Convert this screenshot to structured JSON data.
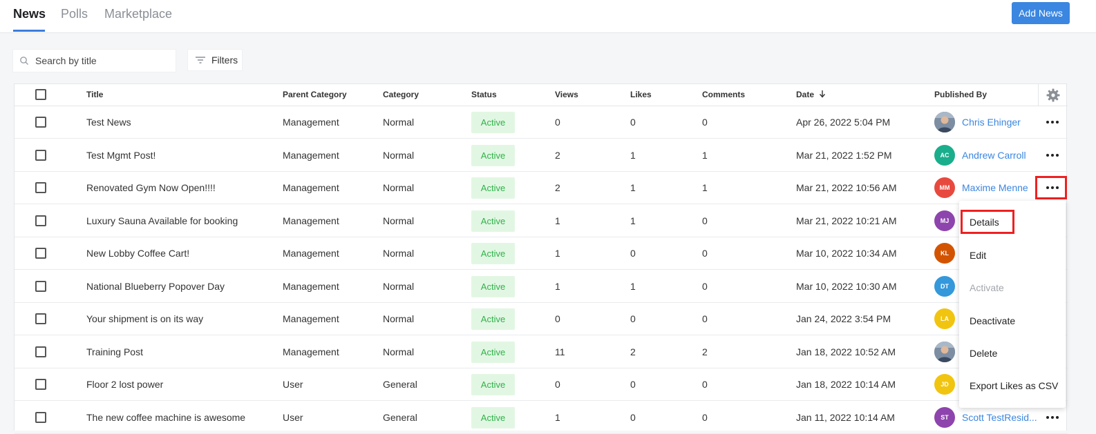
{
  "tabs": [
    {
      "label": "News",
      "active": true
    },
    {
      "label": "Polls",
      "active": false
    },
    {
      "label": "Marketplace",
      "active": false
    }
  ],
  "add_button_label": "Add News",
  "search": {
    "placeholder": "Search by title",
    "value": ""
  },
  "filters_label": "Filters",
  "columns": [
    "Title",
    "Parent Category",
    "Category",
    "Status",
    "Views",
    "Likes",
    "Comments",
    "Date",
    "Published By"
  ],
  "sort_column": "Date",
  "sort_direction": "descending",
  "rows": [
    {
      "title": "Test News",
      "parent_category": "Management",
      "category": "Normal",
      "status": "Active",
      "views": "0",
      "likes": "0",
      "comments": "0",
      "date": "Apr 26, 2022 5:04 PM",
      "initials": "",
      "avatar_color": "#6b7b90",
      "avatar_photo": true,
      "publisher": "Chris Ehinger"
    },
    {
      "title": "Test Mgmt Post!",
      "parent_category": "Management",
      "category": "Normal",
      "status": "Active",
      "views": "2",
      "likes": "1",
      "comments": "1",
      "date": "Mar 21, 2022 1:52 PM",
      "initials": "AC",
      "avatar_color": "#1aae8c",
      "avatar_photo": false,
      "publisher": "Andrew Carroll"
    },
    {
      "title": "Renovated Gym Now Open!!!!",
      "parent_category": "Management",
      "category": "Normal",
      "status": "Active",
      "views": "2",
      "likes": "1",
      "comments": "1",
      "date": "Mar 21, 2022 10:56 AM",
      "initials": "MM",
      "avatar_color": "#e8493f",
      "avatar_photo": false,
      "publisher": "Maxime Menne"
    },
    {
      "title": "Luxury Sauna Available for booking",
      "parent_category": "Management",
      "category": "Normal",
      "status": "Active",
      "views": "1",
      "likes": "1",
      "comments": "0",
      "date": "Mar 21, 2022 10:21 AM",
      "initials": "MJ",
      "avatar_color": "#8e44ad",
      "avatar_photo": false,
      "publisher": ""
    },
    {
      "title": "New Lobby Coffee Cart!",
      "parent_category": "Management",
      "category": "Normal",
      "status": "Active",
      "views": "1",
      "likes": "0",
      "comments": "0",
      "date": "Mar 10, 2022 10:34 AM",
      "initials": "KL",
      "avatar_color": "#d35400",
      "avatar_photo": false,
      "publisher": ""
    },
    {
      "title": "National Blueberry Popover Day",
      "parent_category": "Management",
      "category": "Normal",
      "status": "Active",
      "views": "1",
      "likes": "1",
      "comments": "0",
      "date": "Mar 10, 2022 10:30 AM",
      "initials": "DT",
      "avatar_color": "#3498db",
      "avatar_photo": false,
      "publisher": ""
    },
    {
      "title": "Your shipment is on its way",
      "parent_category": "Management",
      "category": "Normal",
      "status": "Active",
      "views": "0",
      "likes": "0",
      "comments": "0",
      "date": "Jan 24, 2022 3:54 PM",
      "initials": "LA",
      "avatar_color": "#f1c40f",
      "avatar_photo": false,
      "publisher": ""
    },
    {
      "title": "Training Post",
      "parent_category": "Management",
      "category": "Normal",
      "status": "Active",
      "views": "11",
      "likes": "2",
      "comments": "2",
      "date": "Jan 18, 2022 10:52 AM",
      "initials": "",
      "avatar_color": "#6b7b90",
      "avatar_photo": true,
      "publisher": ""
    },
    {
      "title": "Floor 2 lost power",
      "parent_category": "User",
      "category": "General",
      "status": "Active",
      "views": "0",
      "likes": "0",
      "comments": "0",
      "date": "Jan 18, 2022 10:14 AM",
      "initials": "JD",
      "avatar_color": "#f1c40f",
      "avatar_photo": false,
      "publisher": ""
    },
    {
      "title": "The new coffee machine is awesome",
      "parent_category": "User",
      "category": "General",
      "status": "Active",
      "views": "1",
      "likes": "0",
      "comments": "0",
      "date": "Jan 11, 2022 10:14 AM",
      "initials": "ST",
      "avatar_color": "#8e44ad",
      "avatar_photo": false,
      "publisher": "Scott TestResid..."
    }
  ],
  "context_menu": {
    "items": [
      {
        "label": "Details",
        "disabled": false,
        "highlighted": true
      },
      {
        "label": "Edit",
        "disabled": false,
        "highlighted": false
      },
      {
        "label": "Activate",
        "disabled": true,
        "highlighted": false
      },
      {
        "label": "Deactivate",
        "disabled": false,
        "highlighted": false
      },
      {
        "label": "Delete",
        "disabled": false,
        "highlighted": false
      },
      {
        "label": "Export Likes as CSV",
        "disabled": false,
        "highlighted": false
      }
    ]
  },
  "colors": {
    "accent": "#3b86e0",
    "status_bg": "#e2f7e3",
    "status_text": "#2fb14a",
    "highlight": "#ee2020"
  }
}
